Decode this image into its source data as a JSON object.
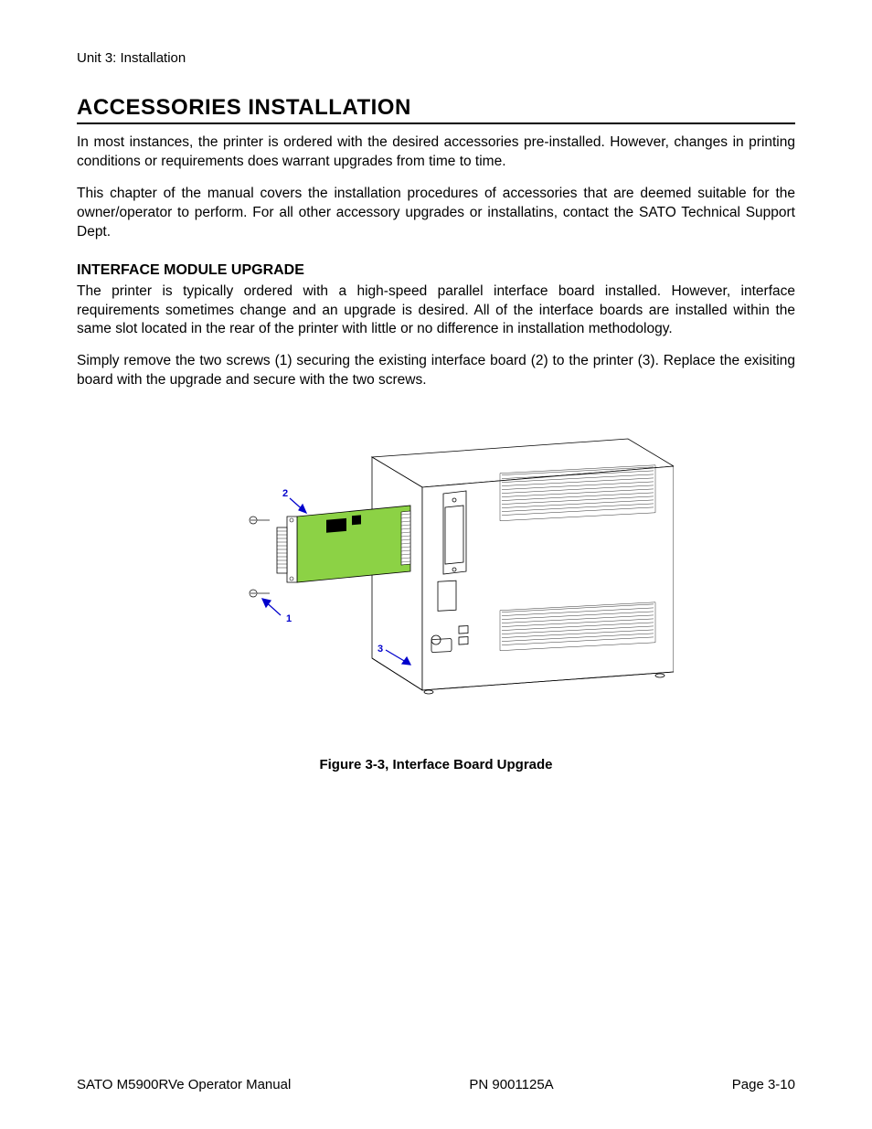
{
  "header": {
    "unit": "Unit 3: Installation"
  },
  "title": "ACCESSORIES INSTALLATION",
  "para1": "In most instances, the printer is ordered with the desired accessories pre-installed. However, changes in printing conditions or requirements does warrant upgrades from time to time.",
  "para2": "This chapter of the manual covers the installation procedures of accessories that are deemed suitable for the owner/operator to perform. For all other accessory upgrades or installatins, contact the SATO Technical Support Dept.",
  "subhead": "INTERFACE MODULE UPGRADE",
  "para3": "The printer is typically ordered with a high-speed parallel interface board installed. However, interface requirements sometimes change and an upgrade is desired. All of the interface boards are installed within the same slot located in the rear of the printer with little or no difference in installation methodology.",
  "para4": "Simply remove the two screws (1) securing the existing interface board (2) to the printer (3). Replace the exisiting board with the upgrade and secure with the two screws.",
  "figure": {
    "caption": "Figure 3-3, Interface Board Upgrade",
    "callouts": {
      "c1": "1",
      "c2": "2",
      "c3": "3"
    }
  },
  "footer": {
    "left": "SATO M5900RVe Operator Manual",
    "center": "PN 9001125A",
    "right": "Page 3-10"
  }
}
